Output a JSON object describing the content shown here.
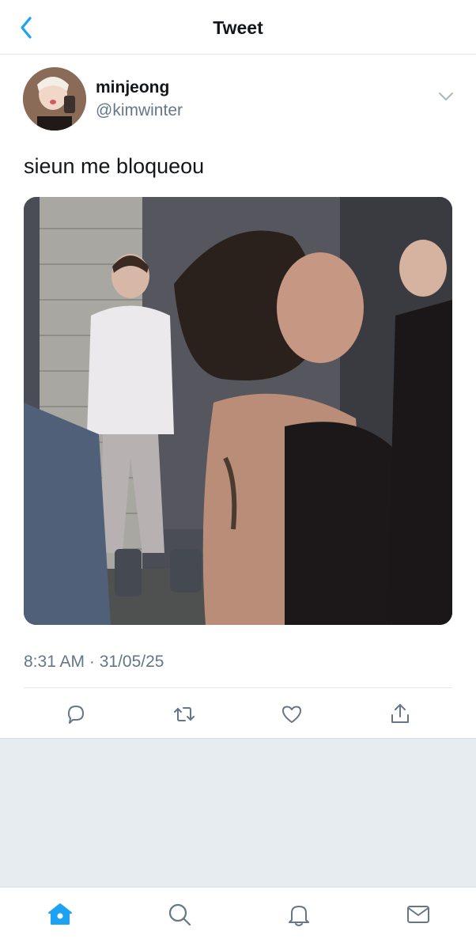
{
  "header": {
    "title": "Tweet",
    "back_icon": "chevron-left-icon"
  },
  "tweet": {
    "author_name": "minjeong",
    "author_handle": "@kimwinter",
    "text": "sieun me bloqueou",
    "timestamp": "8:31 AM · 31/05/25",
    "media_alt": "photo of two women in a hallway",
    "actions": [
      "reply-icon",
      "retweet-icon",
      "like-icon",
      "share-icon"
    ]
  },
  "tabs": [
    "home-icon",
    "search-icon",
    "notifications-icon",
    "messages-icon"
  ],
  "colors": {
    "accent": "#1da1f2",
    "icon_gray": "#657786",
    "text": "#14171a",
    "background_gray": "#e6ecf0"
  }
}
